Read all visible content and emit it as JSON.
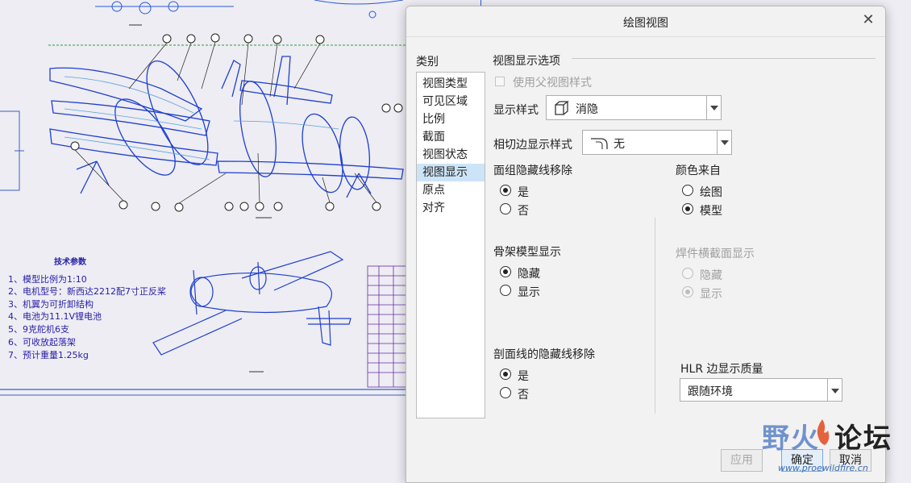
{
  "drawing": {
    "tech_title": "技术参数",
    "tech_lines": [
      "1、模型比例为1:10",
      "2、电机型号：新西达2212配7寸正反桨",
      "3、机翼为可折卸结构",
      "4、电池为11.1V锂电池",
      "5、9克舵机6支",
      "6、可收放起落架",
      "7、预计重量1.25kg"
    ]
  },
  "dialog": {
    "title": "绘图视图",
    "close_glyph": "✕",
    "category_label": "类别",
    "categories": [
      "视图类型",
      "可见区域",
      "比例",
      "截面",
      "视图状态",
      "视图显示",
      "原点",
      "对齐"
    ],
    "selected_category": 5,
    "group_title": "视图显示选项",
    "use_parent_style": "使用父视图样式",
    "display_style_label": "显示样式",
    "display_style_value": "消隐",
    "display_style_icon": "cube-icon",
    "tangent_label": "相切边显示样式",
    "tangent_value": "无",
    "tangent_icon": "tangent-edge-icon",
    "face_hidden": {
      "label": "面组隐藏线移除",
      "options": [
        "是",
        "否"
      ],
      "selected": 0
    },
    "color_from": {
      "label": "颜色来自",
      "options": [
        "绘图",
        "模型"
      ],
      "selected": 1
    },
    "skeleton": {
      "label": "骨架模型显示",
      "options": [
        "隐藏",
        "显示"
      ],
      "selected": 0
    },
    "weld": {
      "label": "焊件横截面显示",
      "options": [
        "隐藏",
        "显示"
      ],
      "selected": 1,
      "disabled": true
    },
    "section_hidden": {
      "label": "剖面线的隐藏线移除",
      "options": [
        "是",
        "否"
      ],
      "selected": 0
    },
    "hlr": {
      "label": "HLR 边显示质量",
      "value": "跟随环境"
    },
    "buttons": {
      "apply": "应用",
      "ok": "确定",
      "cancel": "取消"
    }
  },
  "watermark": {
    "brand_a": "野火",
    "brand_b": "论坛",
    "url": "www.proewildfire.cn"
  },
  "colors": {
    "drawing_blue": "#1f3fd0",
    "drawing_purple": "#6a2aa8",
    "selection": "#cce4f7"
  }
}
